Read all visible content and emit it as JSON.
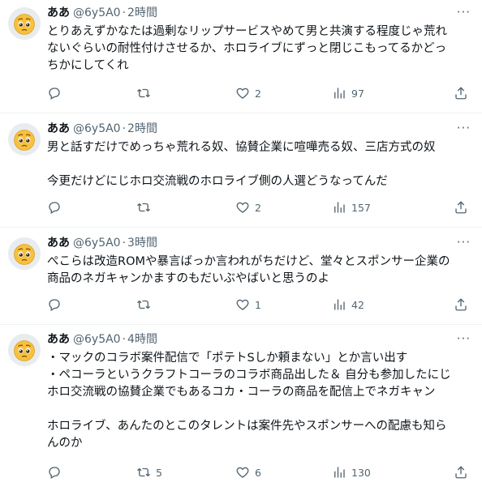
{
  "tweets": [
    {
      "name": "ああ",
      "handle": "@6y5A0",
      "time": "2時間",
      "lines": [
        "とりあえずかなたは過剰なリップサービスやめて男と共演する程度じゃ荒れ",
        "ないぐらいの耐性付けさせるか、ホロライブにずっと閉じこもってるかどっ",
        "ちかにしてくれ"
      ],
      "reply_count": "",
      "retweet_count": "",
      "like_count": "2",
      "view_count": "97"
    },
    {
      "name": "ああ",
      "handle": "@6y5A0",
      "time": "2時間",
      "lines": [
        "男と話すだけでめっちゃ荒れる奴、協賛企業に喧嘩売る奴、三店方式の奴",
        "",
        "今更だけどにじホロ交流戦のホロライブ側の人選どうなってんだ"
      ],
      "reply_count": "",
      "retweet_count": "",
      "like_count": "2",
      "view_count": "157"
    },
    {
      "name": "ああ",
      "handle": "@6y5A0",
      "time": "3時間",
      "lines": [
        "ぺこらは改造ROMや暴言ばっか言われがちだけど、堂々とスポンサー企業の",
        "商品のネガキャンかますのもだいぶやばいと思うのよ"
      ],
      "reply_count": "",
      "retweet_count": "",
      "like_count": "1",
      "view_count": "42"
    },
    {
      "name": "ああ",
      "handle": "@6y5A0",
      "time": "4時間",
      "lines": [
        "・マックのコラボ案件配信で「ポテトSしか頼まない」とか言い出す",
        "・ペコーラというクラフトコーラのコラボ商品出した＆ 自分も参加したにじ",
        "ホロ交流戦の協賛企業でもあるコカ・コーラの商品を配信上でネガキャン",
        "",
        "ホロライブ、あんたのとこのタレントは案件先やスポンサーへの配慮も知ら",
        "んのか"
      ],
      "reply_count": "",
      "retweet_count": "5",
      "like_count": "6",
      "view_count": "130"
    }
  ],
  "ui": {
    "separator": "·",
    "more": "···"
  },
  "icons": [
    "avatar-emoji",
    "reply-icon",
    "retweet-icon",
    "like-icon",
    "views-icon",
    "share-icon"
  ]
}
